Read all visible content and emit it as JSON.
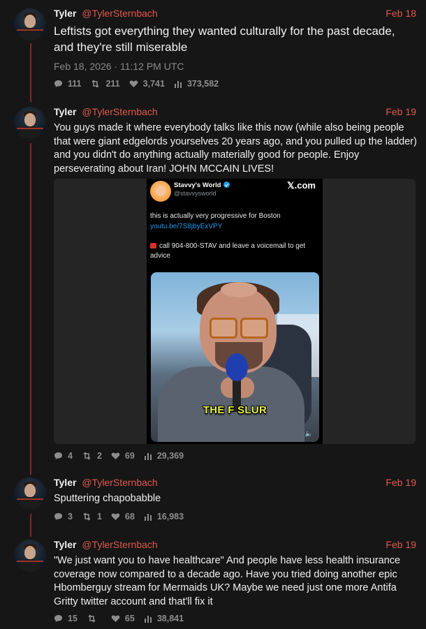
{
  "theme": {
    "background": "#161616",
    "accent": "#e0584f",
    "thread_line": "#7a2a2a"
  },
  "tweets": [
    {
      "name": "Tyler",
      "handle": "@TylerSternbach",
      "date": "Feb 18",
      "text": "Leftists got everything they wanted culturally for the past decade, and they're still miserable",
      "timestamp": "Feb 18, 2026 · 11:12 PM UTC",
      "replies": "111",
      "retweets": "211",
      "likes": "3,741",
      "views": "373,582"
    },
    {
      "name": "Tyler",
      "handle": "@TylerSternbach",
      "date": "Feb 19",
      "text": "You guys made it where everybody talks like this now (while also being people that were giant edgelords yourselves 20 years ago, and you pulled up the ladder) and you didn't do anything actually materially good for people. Enjoy perseverating about Iran! JOHN MCCAIN LIVES!",
      "replies": "4",
      "retweets": "2",
      "likes": "69",
      "views": "29,369",
      "embed": {
        "name": "Stavvy's World",
        "handle": "@stavvysworld",
        "brand": "𝕏.com",
        "text1": "this is actually very progressive for Boston",
        "link": "youtu.be/7S8jbyExVPY",
        "text2": "call 904-800-STAV and leave a voicemail to get advice",
        "caption": "THE F SLUR",
        "sound_icon": "🔈"
      }
    },
    {
      "name": "Tyler",
      "handle": "@TylerSternbach",
      "date": "Feb 19",
      "text": "Sputtering chapobabble",
      "replies": "3",
      "retweets": "1",
      "likes": "68",
      "views": "16,983"
    },
    {
      "name": "Tyler",
      "handle": "@TylerSternbach",
      "date": "Feb 19",
      "text": "\"We just want you to have healthcare\" And people have less health insurance coverage now compared to a decade ago. Have you tried doing another epic Hbomberguy stream for Mermaids UK? Maybe we need just one more Antifa Gritty twitter account and that'll fix it",
      "replies": "15",
      "retweets": "",
      "likes": "65",
      "views": "38,841"
    }
  ]
}
